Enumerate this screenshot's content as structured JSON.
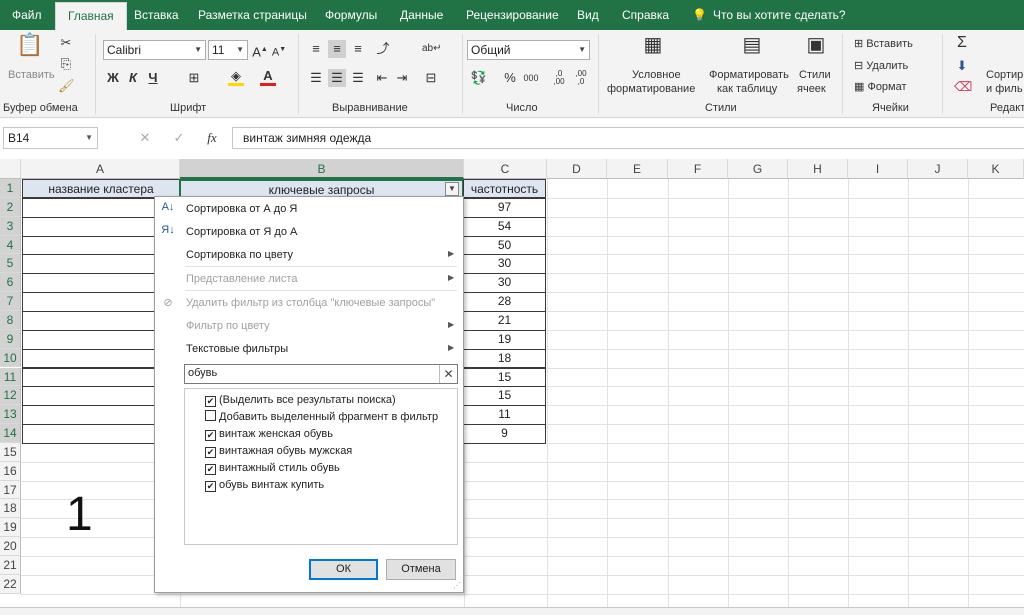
{
  "ribbon_tabs": {
    "file": "Файл",
    "home": "Главная",
    "insert": "Вставка",
    "layout": "Разметка страницы",
    "formulas": "Формулы",
    "data": "Данные",
    "review": "Рецензирование",
    "view": "Вид",
    "help": "Справка",
    "tellme": "Что вы хотите сделать?"
  },
  "ribbon": {
    "paste": "Вставить",
    "clipboard": "Буфер обмена",
    "font_name": "Calibri",
    "font_size": "11",
    "bold": "Ж",
    "italic": "К",
    "underline": "Ч",
    "font_group": "Шрифт",
    "alignment_group": "Выравнивание",
    "number_format": "Общий",
    "number_group": "Число",
    "percent": "%",
    "thousands": "000",
    "dec_inc": ",0\n,00",
    "dec_dec": ",00\n,0",
    "cond_format_1": "Условное",
    "cond_format_2": "форматирование",
    "format_table_1": "Форматировать",
    "format_table_2": "как таблицу",
    "cell_styles_1": "Стили",
    "cell_styles_2": "ячеек",
    "styles_group": "Стили",
    "insert": "Вставить",
    "delete": "Удалить",
    "format": "Формат",
    "cells_group": "Ячейки",
    "sort_1": "Сортир",
    "sort_2": "и филь",
    "edit_group": "Редакт",
    "sigma": "Σ"
  },
  "formula_bar": {
    "name_box": "B14",
    "fx": "fx",
    "value": "винтаж зимняя одежда"
  },
  "columns": [
    "A",
    "B",
    "C",
    "D",
    "E",
    "F",
    "G",
    "H",
    "I",
    "J",
    "K"
  ],
  "rows": [
    "1",
    "2",
    "3",
    "4",
    "5",
    "6",
    "7",
    "8",
    "9",
    "10",
    "11",
    "12",
    "13",
    "14",
    "15",
    "16",
    "17",
    "18",
    "19",
    "20",
    "21",
    "22"
  ],
  "table": {
    "header_a": "название кластера",
    "header_b": "ключевые запросы",
    "header_c": "частотность",
    "frequencies": [
      "97",
      "54",
      "50",
      "30",
      "30",
      "28",
      "21",
      "19",
      "18",
      "15",
      "15",
      "11",
      "9"
    ]
  },
  "big_number": "1",
  "filter_menu": {
    "sort_az": "Сортировка от А до Я",
    "sort_za": "Сортировка от Я до А",
    "sort_color": "Сортировка по цвету",
    "sheet_view": "Представление листа",
    "clear_filter": "Удалить фильтр из столбца \"ключевые запросы\"",
    "filter_color": "Фильтр по цвету",
    "text_filters": "Текстовые фильтры",
    "search_value": "обувь",
    "items": [
      {
        "label": "(Выделить все результаты поиска)",
        "checked": true
      },
      {
        "label": "Добавить выделенный фрагмент в фильтр",
        "checked": false
      },
      {
        "label": "винтаж женская обувь",
        "checked": true
      },
      {
        "label": "винтажная обувь мужская",
        "checked": true
      },
      {
        "label": "винтажный стиль обувь",
        "checked": true
      },
      {
        "label": "обувь винтаж купить",
        "checked": true
      }
    ],
    "ok": "ОК",
    "cancel": "Отмена"
  },
  "colors": {
    "excel_green": "#217346",
    "header_fill": "#dde5f1"
  }
}
